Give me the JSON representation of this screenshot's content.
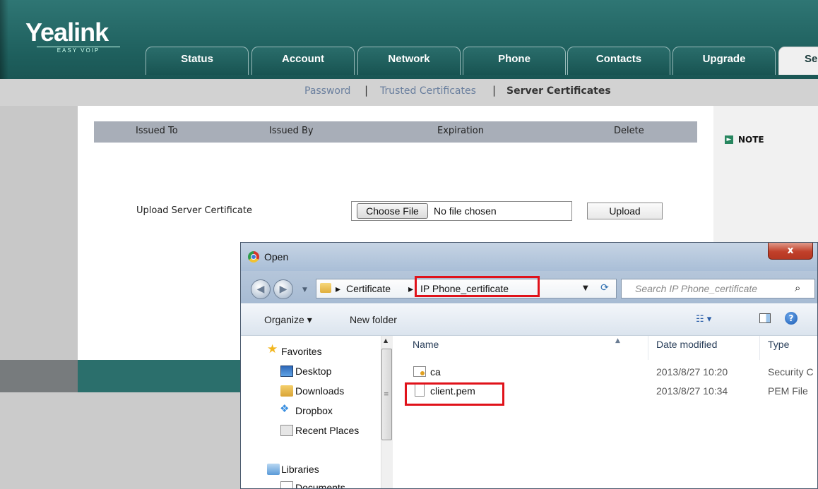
{
  "brand": {
    "logo_text": "Yealink",
    "logo_sub": "EASY VOIP"
  },
  "tabs": [
    {
      "label": "Status"
    },
    {
      "label": "Account"
    },
    {
      "label": "Network"
    },
    {
      "label": "Phone"
    },
    {
      "label": "Contacts"
    },
    {
      "label": "Upgrade"
    },
    {
      "label": "Se"
    }
  ],
  "subnav": {
    "items": [
      "Password",
      "Trusted Certificates",
      "Server Certificates"
    ],
    "separator": "|"
  },
  "table": {
    "headers": [
      "Issued To",
      "Issued By",
      "Expiration",
      "Delete"
    ]
  },
  "note": {
    "label": "NOTE",
    "icon": "arrow-right-icon"
  },
  "upload": {
    "label": "Upload Server Certificate",
    "choose_button": "Choose File",
    "no_file_text": "No file chosen",
    "upload_button": "Upload"
  },
  "dialog": {
    "title": "Open",
    "close_glyph": "x",
    "address": {
      "crumbs": [
        "Certificate",
        "IP Phone_certificate"
      ]
    },
    "search_placeholder": "Search IP Phone_certificate",
    "toolbar": {
      "organize": "Organize ▾",
      "new_folder": "New folder"
    },
    "nav": {
      "favorites_label": "Favorites",
      "favorites": [
        "Desktop",
        "Downloads",
        "Dropbox",
        "Recent Places"
      ],
      "libraries_label": "Libraries",
      "libraries": [
        "Documents"
      ]
    },
    "columns": [
      "Name",
      "Date modified",
      "Type"
    ],
    "files": [
      {
        "name": "ca",
        "date": "2013/8/27 10:20",
        "type": "Security C",
        "icon": "certificate-icon"
      },
      {
        "name": "client.pem",
        "date": "2013/8/27 10:34",
        "type": "PEM File",
        "icon": "file-icon"
      }
    ]
  },
  "colors": {
    "header": "#1e5f5d",
    "highlight": "#e0121a",
    "table_header": "#a8aeb8",
    "note_icon": "#27865f"
  }
}
